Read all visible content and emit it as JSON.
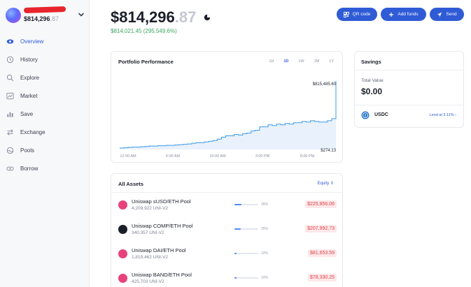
{
  "account": {
    "balance_main": "$814,296",
    "balance_cents": ".87"
  },
  "nav": [
    {
      "label": "Overview",
      "icon": "eye-icon",
      "active": true
    },
    {
      "label": "History",
      "icon": "history-icon"
    },
    {
      "label": "Explore",
      "icon": "search-icon"
    },
    {
      "label": "Market",
      "icon": "market-chart-icon"
    },
    {
      "label": "Save",
      "icon": "bar-chart-icon"
    },
    {
      "label": "Exchange",
      "icon": "exchange-icon"
    },
    {
      "label": "Pools",
      "icon": "pools-icon"
    },
    {
      "label": "Borrow",
      "icon": "borrow-icon"
    }
  ],
  "header": {
    "balance_main": "$814,296",
    "balance_cents": ".87",
    "gain": "$814,021.45 (295,549.6%)",
    "buttons": {
      "qr": "QR code",
      "add": "Add funds",
      "send": "Send"
    }
  },
  "performance": {
    "title": "Portfolio Performance",
    "ranges": [
      "1H",
      "1D",
      "1W",
      "1M",
      "1Y"
    ],
    "active_range": "1D",
    "high_label": "$815,485.60",
    "low_label": "$274.13"
  },
  "chart_data": {
    "type": "area",
    "x_ticks": [
      "12:00 AM",
      "5:00 AM",
      "10:00 AM",
      "3:00 PM",
      "8:00 PM"
    ],
    "x": [
      0,
      1,
      2,
      3,
      4,
      5,
      6,
      7,
      8,
      9,
      10,
      11,
      12,
      13,
      14,
      15,
      16,
      17,
      18,
      19,
      20,
      21,
      22,
      23,
      24,
      25,
      26,
      27,
      28,
      29,
      30,
      31,
      32,
      33,
      34,
      35,
      36,
      37,
      38,
      39,
      40,
      41,
      42,
      43,
      44,
      45,
      46,
      47,
      48,
      49,
      50,
      51
    ],
    "values": [
      0.02,
      0.025,
      0.03,
      0.035,
      0.035,
      0.04,
      0.045,
      0.05,
      0.05,
      0.055,
      0.055,
      0.06,
      0.06,
      0.065,
      0.07,
      0.075,
      0.08,
      0.09,
      0.1,
      0.1,
      0.11,
      0.12,
      0.13,
      0.15,
      0.18,
      0.2,
      0.2,
      0.22,
      0.21,
      0.23,
      0.24,
      0.27,
      0.28,
      0.33,
      0.33,
      0.36,
      0.35,
      0.37,
      0.36,
      0.38,
      0.37,
      0.39,
      0.39,
      0.41,
      0.4,
      0.42,
      0.41,
      0.4,
      0.4,
      0.42,
      0.45,
      1.0
    ],
    "ylim": [
      0,
      1
    ],
    "color": "#3d9be9",
    "fill": "#e8f1fc"
  },
  "savings": {
    "title": "Savings",
    "total_label": "Total Value",
    "total_value": "$0.00",
    "asset": "USDC",
    "lend_label": "Lend at 3.11%"
  },
  "assets": {
    "title": "All Assets",
    "sort_label": "Equity",
    "rows": [
      {
        "name": "Uniswap sUSD/ETH Pool",
        "qty": "4,209,922 UNI-V2",
        "pct": "28%",
        "pct_value": 28,
        "value": "$225,856.06",
        "token_color": "#e8427a"
      },
      {
        "name": "Uniswap COMP/ETH Pool",
        "qty": "340,357 UNI-V2",
        "pct": "25%",
        "pct_value": 25,
        "value": "$207,992.73",
        "token_color": "#1b1f2a"
      },
      {
        "name": "Uniswap DAI/ETH Pool",
        "qty": "1,819,462 UNI-V2",
        "pct": "10%",
        "pct_value": 10,
        "value": "$81,653.59",
        "token_color": "#e8427a"
      },
      {
        "name": "Uniswap BAND/ETH Pool",
        "qty": "425,703 UNI-V2",
        "pct": "10%",
        "pct_value": 10,
        "value": "$78,330.25",
        "token_color": "#e8427a"
      }
    ]
  },
  "colors": {
    "accent": "#2f5bd6",
    "gain": "#3aa55f",
    "loss": "#e0424a"
  }
}
